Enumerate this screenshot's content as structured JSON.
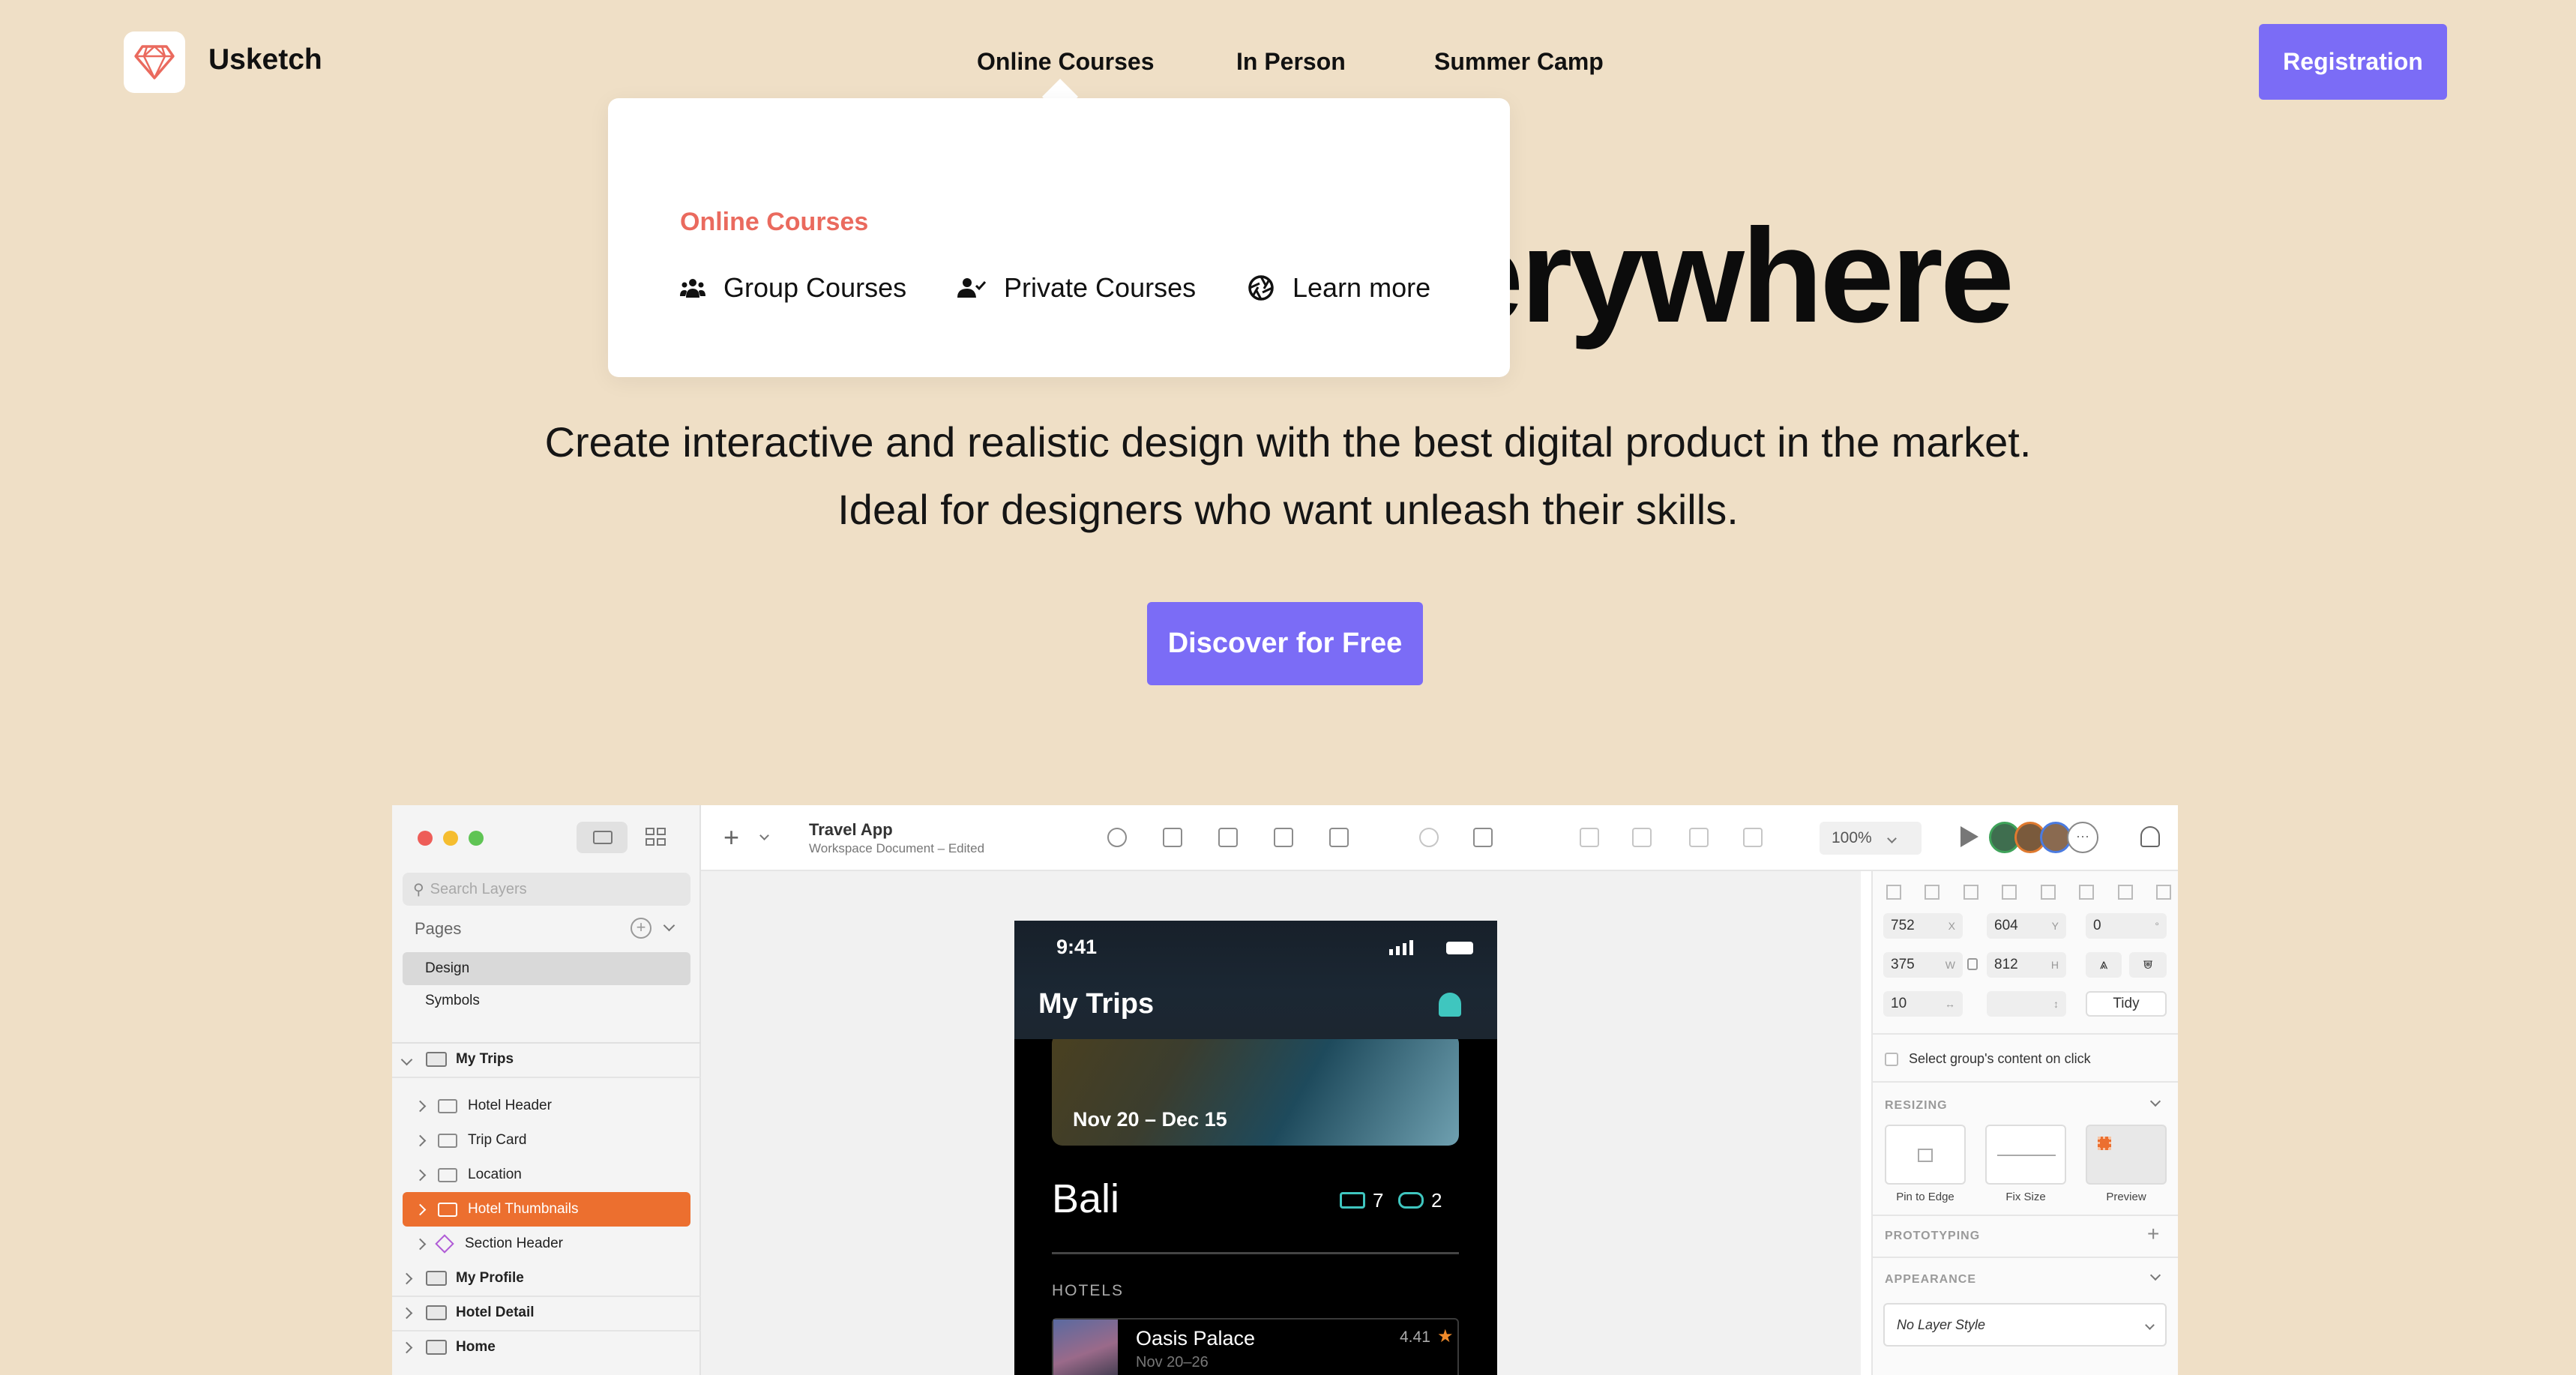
{
  "brand": {
    "name": "Usketch",
    "logo": "diamond-icon"
  },
  "nav": {
    "links": [
      "Online Courses",
      "In Person",
      "Summer Camp"
    ],
    "registration": "Registration"
  },
  "dropdown": {
    "heading": "Online Courses",
    "items": [
      {
        "label": "Group Courses",
        "icon": "group-icon"
      },
      {
        "label": "Private Courses",
        "icon": "user-check-icon"
      },
      {
        "label": "Learn more",
        "icon": "aperture-icon"
      }
    ]
  },
  "hero": {
    "title_visible": "erywhere",
    "subtitle": "Create interactive and realistic design with the best digital product in the market. Ideal for designers who want unleash their skills.",
    "cta": "Discover for Free"
  },
  "colors": {
    "accent": "#7b6cf6",
    "background": "#efdfc6",
    "dropdown_heading": "#ea6a5e",
    "selected_layer": "#ec6f2f"
  },
  "app": {
    "doc_title": "Travel App",
    "doc_subtitle": "Workspace Document – Edited",
    "zoom": "100%",
    "search_placeholder": "Search Layers",
    "pages_label": "Pages",
    "pages": [
      "Design",
      "Symbols"
    ],
    "layers": [
      {
        "label": "My Trips",
        "level": 0,
        "expanded": true,
        "kind": "artboard"
      },
      {
        "label": "Hotel Header",
        "level": 1,
        "kind": "folder"
      },
      {
        "label": "Trip Card",
        "level": 1,
        "kind": "folder"
      },
      {
        "label": "Location",
        "level": 1,
        "kind": "folder"
      },
      {
        "label": "Hotel Thumbnails",
        "level": 1,
        "kind": "folder",
        "selected": true
      },
      {
        "label": "Section Header",
        "level": 1,
        "kind": "symbol"
      },
      {
        "label": "My Profile",
        "level": 0,
        "kind": "artboard"
      },
      {
        "label": "Hotel Detail",
        "level": 0,
        "kind": "artboard"
      },
      {
        "label": "Home",
        "level": 0,
        "kind": "artboard"
      }
    ],
    "inspector": {
      "x": "752",
      "x_label": "X",
      "y": "604",
      "y_label": "Y",
      "rot": "0",
      "rot_label": "°",
      "w": "375",
      "w_label": "W",
      "h": "812",
      "h_label": "H",
      "spacing": "10",
      "spacing_label": "↔",
      "vspacing_label": "↕",
      "tidy": "Tidy",
      "select_group": "Select group's content on click",
      "resizing": "RESIZING",
      "resize_options": [
        "Pin to Edge",
        "Fix Size",
        "Preview"
      ],
      "prototyping": "PROTOTYPING",
      "appearance": "APPEARANCE",
      "layer_style": "No Layer Style"
    },
    "phone": {
      "time": "9:41",
      "title": "My Trips",
      "dates": "Nov 20 – Dec 15",
      "destination": "Bali",
      "beds": "7",
      "binoculars": "2",
      "section": "HOTELS",
      "hotel_name": "Oasis Palace",
      "hotel_dates": "Nov 20–26",
      "hotel_rating": "4.41"
    }
  }
}
